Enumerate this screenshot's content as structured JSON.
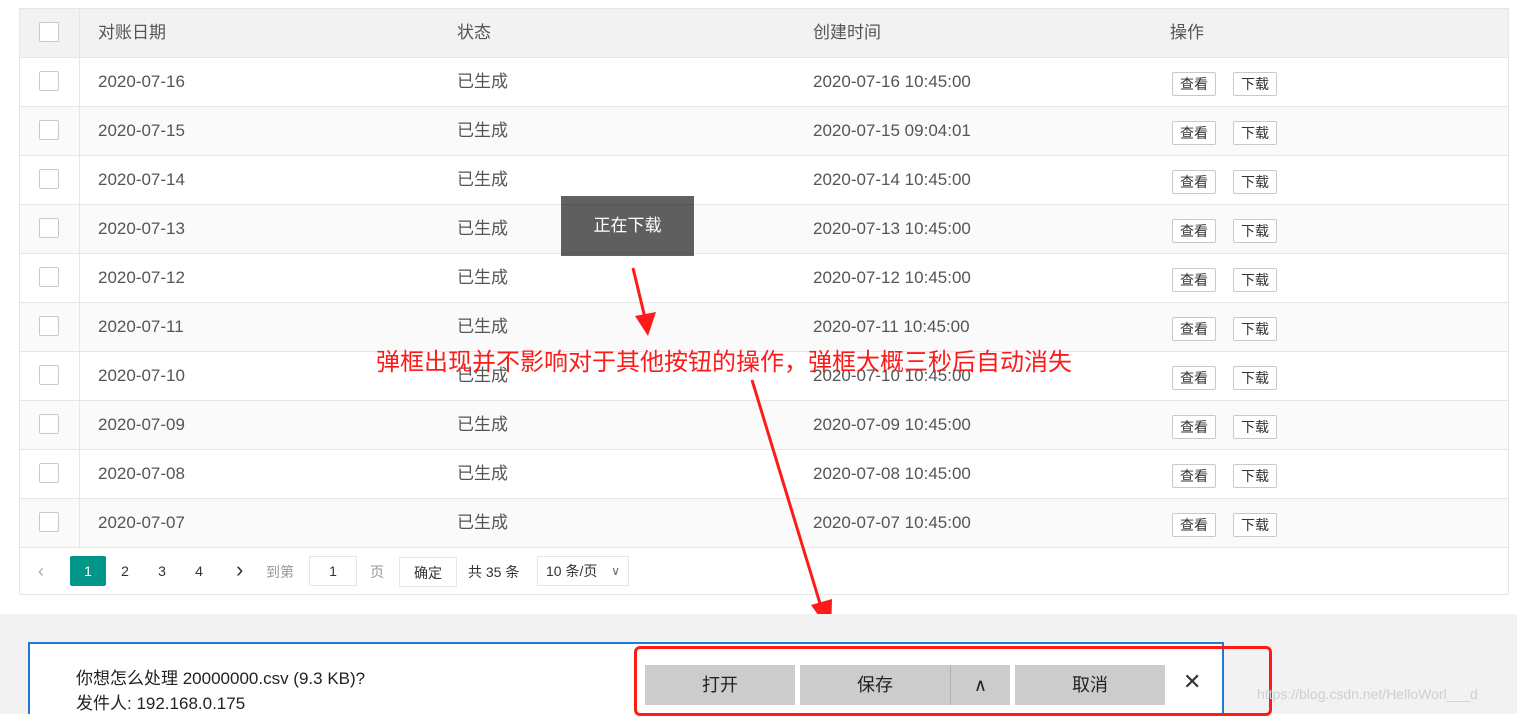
{
  "table": {
    "headers": {
      "date": "对账日期",
      "status": "状态",
      "created": "创建时间",
      "action": "操作"
    },
    "action_view": "查看",
    "action_download": "下载",
    "rows": [
      {
        "date": "2020-07-16",
        "status": "已生成",
        "created": "2020-07-16 10:45:00"
      },
      {
        "date": "2020-07-15",
        "status": "已生成",
        "created": "2020-07-15 09:04:01"
      },
      {
        "date": "2020-07-14",
        "status": "已生成",
        "created": "2020-07-14 10:45:00"
      },
      {
        "date": "2020-07-13",
        "status": "已生成",
        "created": "2020-07-13 10:45:00"
      },
      {
        "date": "2020-07-12",
        "status": "已生成",
        "created": "2020-07-12 10:45:00"
      },
      {
        "date": "2020-07-11",
        "status": "已生成",
        "created": "2020-07-11 10:45:00"
      },
      {
        "date": "2020-07-10",
        "status": "已生成",
        "created": "2020-07-10 10:45:00"
      },
      {
        "date": "2020-07-09",
        "status": "已生成",
        "created": "2020-07-09 10:45:00"
      },
      {
        "date": "2020-07-08",
        "status": "已生成",
        "created": "2020-07-08 10:45:00"
      },
      {
        "date": "2020-07-07",
        "status": "已生成",
        "created": "2020-07-07 10:45:00"
      }
    ]
  },
  "pagination": {
    "pages": [
      "1",
      "2",
      "3",
      "4"
    ],
    "current_page": "1",
    "goto_label": "到第",
    "goto_value": "1",
    "page_unit": "页",
    "confirm_label": "确定",
    "total_label": "共 35 条",
    "page_size": "10 条/页"
  },
  "toast": {
    "text": "正在下载"
  },
  "annotation": {
    "text": "弹框出现并不影响对于其他按钮的操作，弹框大概三秒后自动消失"
  },
  "download_bar": {
    "question": "你想怎么处理 20000000.csv (9.3 KB)?",
    "sender": "发件人: 192.168.0.175",
    "open_label": "打开",
    "save_label": "保存",
    "cancel_label": "取消"
  },
  "watermark": "https://blog.csdn.net/HelloWorl___d",
  "colors": {
    "accent": "#009688",
    "annotation_red": "#ff1a1a",
    "dialog_blue": "#1e7ad6"
  },
  "icons": {
    "prev": "chevron-left-icon",
    "next": "chevron-right-icon",
    "dropdown": "chevron-down-icon",
    "save_options": "chevron-up-icon",
    "close": "close-icon"
  }
}
